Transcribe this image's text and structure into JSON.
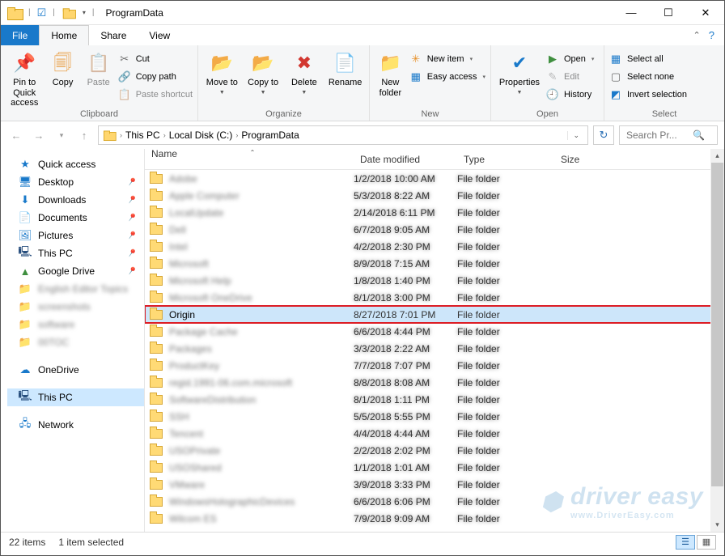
{
  "window": {
    "title": "ProgramData"
  },
  "qat": {
    "check_state": "☑",
    "item_drop": "▾"
  },
  "tabs": {
    "file": "File",
    "home": "Home",
    "share": "Share",
    "view": "View"
  },
  "ribbon": {
    "clipboard": {
      "label": "Clipboard",
      "pin": "Pin to Quick access",
      "copy": "Copy",
      "paste": "Paste",
      "cut": "Cut",
      "copy_path": "Copy path",
      "paste_shortcut": "Paste shortcut"
    },
    "organize": {
      "label": "Organize",
      "move_to": "Move to",
      "copy_to": "Copy to",
      "delete": "Delete",
      "rename": "Rename"
    },
    "new": {
      "label": "New",
      "new_folder": "New folder",
      "new_item": "New item",
      "easy_access": "Easy access"
    },
    "open": {
      "label": "Open",
      "properties": "Properties",
      "open": "Open",
      "edit": "Edit",
      "history": "History"
    },
    "select": {
      "label": "Select",
      "select_all": "Select all",
      "select_none": "Select none",
      "invert": "Invert selection"
    }
  },
  "breadcrumb": {
    "pc": "This PC",
    "drive": "Local Disk (C:)",
    "folder": "ProgramData"
  },
  "search": {
    "placeholder": "Search Pr..."
  },
  "columns": {
    "name": "Name",
    "date": "Date modified",
    "type": "Type",
    "size": "Size"
  },
  "sidebar": {
    "quick_access": "Quick access",
    "desktop": "Desktop",
    "downloads": "Downloads",
    "documents": "Documents",
    "pictures": "Pictures",
    "this_pc": "This PC",
    "google_drive": "Google Drive",
    "onedrive": "OneDrive",
    "this_pc2": "This PC",
    "network": "Network"
  },
  "highlighted": {
    "name": "Origin",
    "date": "8/27/2018 7:01 PM",
    "type": "File folder"
  },
  "blurred_rows": [
    {
      "n": "Adobe",
      "d": "1/2/2018 10:00 AM",
      "t": "File folder"
    },
    {
      "n": "Apple Computer",
      "d": "5/3/2018 8:22 AM",
      "t": "File folder"
    },
    {
      "n": "LocalUpdate",
      "d": "2/14/2018 6:11 PM",
      "t": "File folder"
    },
    {
      "n": "Dell",
      "d": "6/7/2018 9:05 AM",
      "t": "File folder"
    },
    {
      "n": "Intel",
      "d": "4/2/2018 2:30 PM",
      "t": "File folder"
    },
    {
      "n": "Microsoft",
      "d": "8/9/2018 7:15 AM",
      "t": "File folder"
    },
    {
      "n": "Microsoft Help",
      "d": "1/8/2018 1:40 PM",
      "t": "File folder"
    },
    {
      "n": "Microsoft OneDrive",
      "d": "8/1/2018 3:00 PM",
      "t": "File folder"
    }
  ],
  "blurred_rows_after": [
    {
      "n": "Package Cache",
      "d": "6/6/2018 4:44 PM",
      "t": "File folder"
    },
    {
      "n": "Packages",
      "d": "3/3/2018 2:22 AM",
      "t": "File folder"
    },
    {
      "n": "ProductKey",
      "d": "7/7/2018 7:07 PM",
      "t": "File folder"
    },
    {
      "n": "regid.1991-06.com.microsoft",
      "d": "8/8/2018 8:08 AM",
      "t": "File folder"
    },
    {
      "n": "SoftwareDistribution",
      "d": "8/1/2018 1:11 PM",
      "t": "File folder"
    },
    {
      "n": "SSH",
      "d": "5/5/2018 5:55 PM",
      "t": "File folder"
    },
    {
      "n": "Tencent",
      "d": "4/4/2018 4:44 AM",
      "t": "File folder"
    },
    {
      "n": "USOPrivate",
      "d": "2/2/2018 2:02 PM",
      "t": "File folder"
    },
    {
      "n": "USOShared",
      "d": "1/1/2018 1:01 AM",
      "t": "File folder"
    },
    {
      "n": "VMware",
      "d": "3/9/2018 3:33 PM",
      "t": "File folder"
    },
    {
      "n": "WindowsHolographicDevices",
      "d": "6/6/2018 6:06 PM",
      "t": "File folder"
    },
    {
      "n": "Wilcom ES",
      "d": "7/9/2018 9:09 AM",
      "t": "File folder"
    }
  ],
  "sidebar_blur": [
    "English Editor Topics",
    "screenshots",
    "software",
    "00TOC"
  ],
  "status": {
    "count": "22 items",
    "selected": "1 item selected"
  },
  "watermark": {
    "brand": "driver easy",
    "url": "www.DriverEasy.com"
  }
}
